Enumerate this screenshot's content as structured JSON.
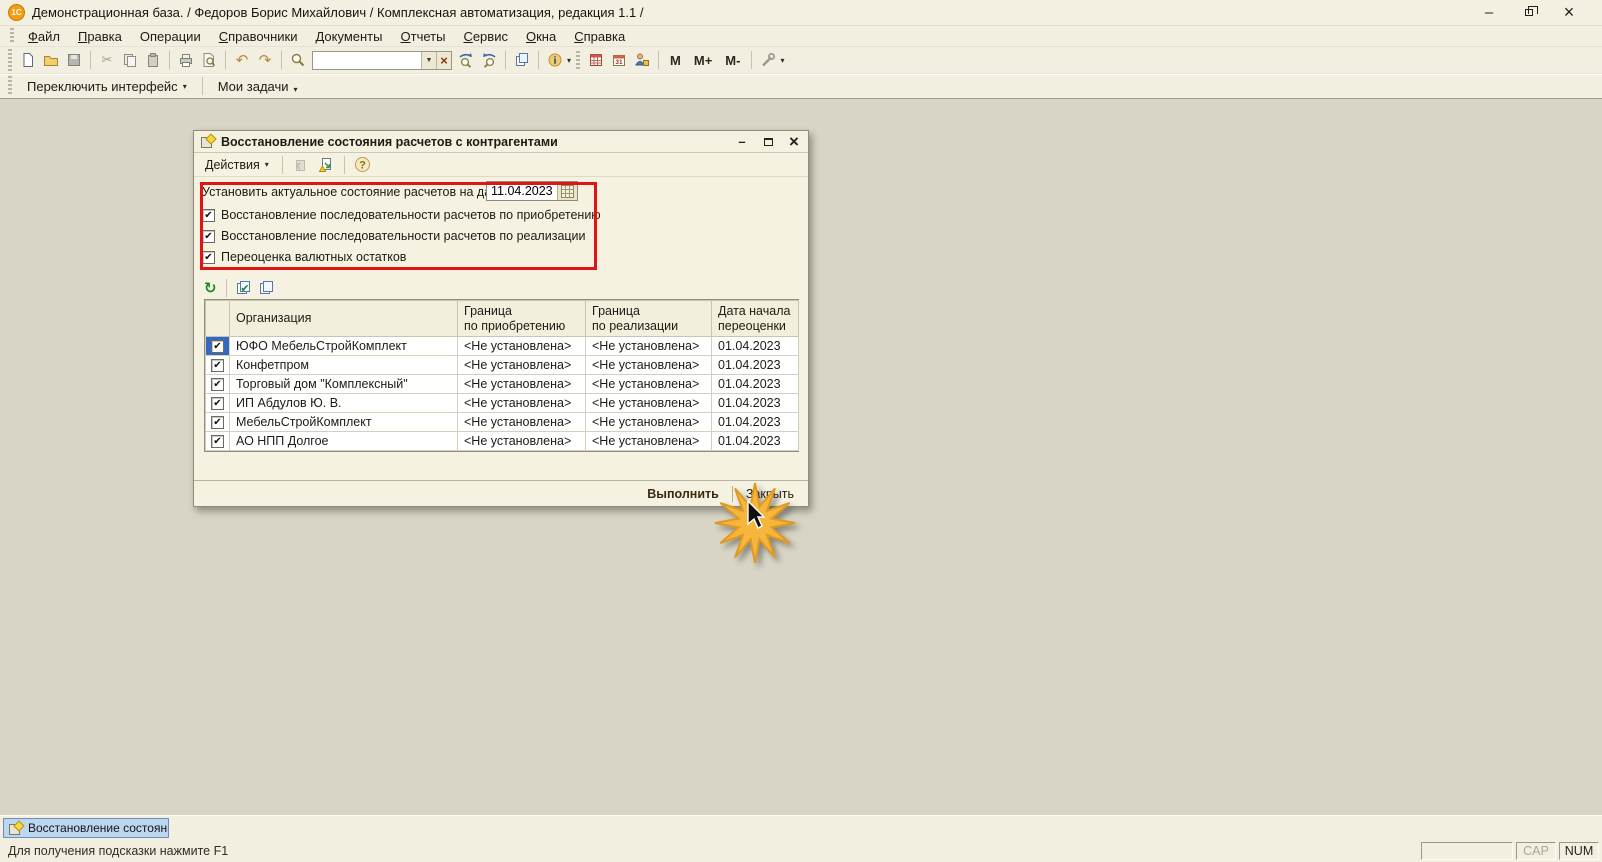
{
  "app": {
    "logo_text": "1С",
    "title": "Демонстрационная база. / Федоров Борис Михайлович / Комплексная автоматизация, редакция 1.1 /"
  },
  "menu": {
    "items": [
      "Файл",
      "Правка",
      "Операции",
      "Справочники",
      "Документы",
      "Отчеты",
      "Сервис",
      "Окна",
      "Справка"
    ]
  },
  "toolbar": {
    "search_value": "",
    "m": "M",
    "m_plus": "M+",
    "m_minus": "M-"
  },
  "interface_bar": {
    "switch_interface": "Переключить интерфейс",
    "my_tasks": "Мои задачи"
  },
  "dialog": {
    "title": "Восстановление состояния расчетов с контрагентами",
    "toolbar": {
      "actions": "Действия"
    },
    "settings": {
      "date_label": "Установить актуальное состояние расчетов на дату:",
      "date_value": "11.04.2023",
      "options": [
        {
          "label": "Восстановление последовательности расчетов по приобретению",
          "checked": true
        },
        {
          "label": "Восстановление последовательности расчетов по реализации",
          "checked": true
        },
        {
          "label": "Переоценка валютных остатков",
          "checked": true
        }
      ]
    },
    "table": {
      "headers": [
        "",
        "Организация",
        "Граница\nпо приобретению",
        "Граница\nпо реализации",
        "Дата начала\nпереоценки"
      ],
      "rows": [
        {
          "checked": true,
          "selected": true,
          "org": "ЮФО МебельСтройКомплект",
          "purchase_boundary": "<Не установлена>",
          "sales_boundary": "<Не установлена>",
          "revaluation_start": "01.04.2023"
        },
        {
          "checked": true,
          "selected": false,
          "org": "Конфетпром",
          "purchase_boundary": "<Не установлена>",
          "sales_boundary": "<Не установлена>",
          "revaluation_start": "01.04.2023"
        },
        {
          "checked": true,
          "selected": false,
          "org": "Торговый дом \"Комплексный\"",
          "purchase_boundary": "<Не установлена>",
          "sales_boundary": "<Не установлена>",
          "revaluation_start": "01.04.2023"
        },
        {
          "checked": true,
          "selected": false,
          "org": "ИП Абдулов Ю. В.",
          "purchase_boundary": "<Не установлена>",
          "sales_boundary": "<Не установлена>",
          "revaluation_start": "01.04.2023"
        },
        {
          "checked": true,
          "selected": false,
          "org": "МебельСтройКомплект",
          "purchase_boundary": "<Не установлена>",
          "sales_boundary": "<Не установлена>",
          "revaluation_start": "01.04.2023"
        },
        {
          "checked": true,
          "selected": false,
          "org": "АО НПП Долгое",
          "purchase_boundary": "<Не установлена>",
          "sales_boundary": "<Не установлена>",
          "revaluation_start": "01.04.2023"
        }
      ]
    },
    "buttons": {
      "execute": "Выполнить",
      "close": "Закрыть"
    }
  },
  "taskbar": {
    "active_tab": "Восстановление состояния ..."
  },
  "status_bar": {
    "hint": "Для получения подсказки нажмите F1",
    "cap": "CAP",
    "num": "NUM"
  },
  "icons": {
    "check": "✔",
    "dropdown": "▾",
    "combo_arrow": "▼",
    "clear": "×",
    "minimize": "–",
    "close": "×",
    "cut": "✂",
    "undo": "↶",
    "redo": "↷",
    "refresh": "↻",
    "help": "?",
    "info": "i"
  },
  "annotation": {
    "highlight_color": "#e01414",
    "selection_color": "#316ac5"
  }
}
